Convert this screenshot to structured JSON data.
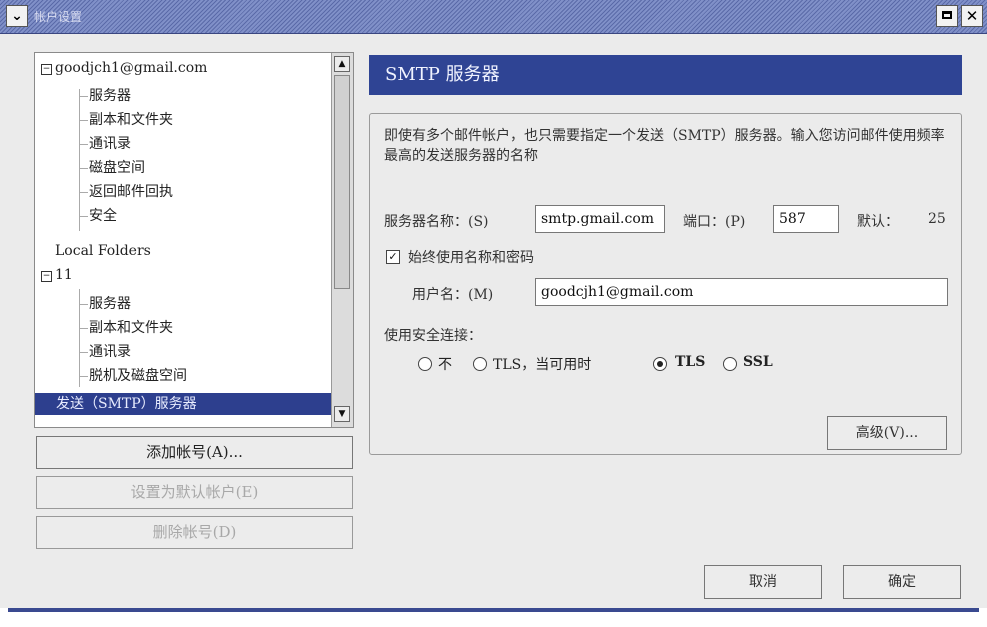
{
  "window": {
    "title": "帐户设置"
  },
  "tree": {
    "items": [
      {
        "label": "goodjch1@gmail.com",
        "toggle": "⊟"
      },
      {
        "label": "服务器"
      },
      {
        "label": "副本和文件夹"
      },
      {
        "label": "通讯录"
      },
      {
        "label": "磁盘空间"
      },
      {
        "label": "返回邮件回执"
      },
      {
        "label": "安全"
      },
      {
        "label": "Local Folders"
      },
      {
        "label": "11",
        "toggle": "⊟"
      },
      {
        "label": "服务器"
      },
      {
        "label": "副本和文件夹"
      },
      {
        "label": "通讯录"
      },
      {
        "label": "脱机及磁盘空间"
      },
      {
        "label": "发送（SMTP）服务器"
      }
    ]
  },
  "left_buttons": {
    "add_account": "添加帐号(A)...",
    "set_default": "设置为默认帐户(E)",
    "delete_account": "删除帐号(D)"
  },
  "panel": {
    "header": "SMTP 服务器",
    "description": "即使有多个邮件帐户，也只需要指定一个发送（SMTP）服务器。输入您访问邮件使用频率最高的发送服务器的名称",
    "server_label": "服务器名称：(S)",
    "server_value": "smtp.gmail.com",
    "port_label": "端口：(P)",
    "port_value": "587",
    "default_label": "默认：",
    "default_value": "25",
    "always_use_label": "始终使用名称和密码",
    "username_label": "用户名：(M)",
    "username_value": "goodcjh1@gmail.com",
    "secure_label": "使用安全连接：",
    "secure_options": [
      "不",
      "TLS，当可用时",
      "TLS",
      "SSL"
    ],
    "secure_selected": "TLS",
    "advanced_button": "高级(V)..."
  },
  "footer": {
    "cancel": "取消",
    "ok": "确定"
  }
}
